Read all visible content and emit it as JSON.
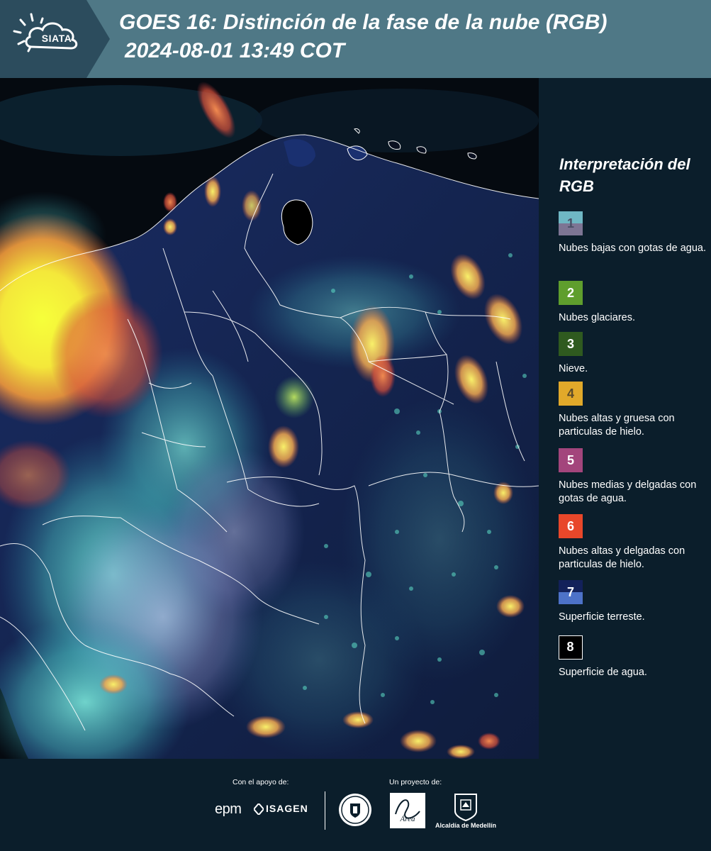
{
  "header": {
    "logo_text": "SIATA",
    "title": "GOES 16: Distinción de la fase de la nube (RGB)",
    "timestamp": "2024-08-01 13:49 COT"
  },
  "legend": {
    "title": "Interpretación del RGB",
    "items": [
      {
        "number": "1",
        "label": "Nubes bajas con gotas de agua.",
        "color_top": "#6fb7c4",
        "color_bottom": "#7d7594",
        "text_color": "#4a4f66"
      },
      {
        "number": "2",
        "label": "Nubes glaciares.",
        "color_top": "#5f9e2d",
        "color_bottom": "#5f9e2d",
        "text_color": "#ffffff"
      },
      {
        "number": "3",
        "label": "Nieve.",
        "color_top": "#2f5a1f",
        "color_bottom": "#2f5a1f",
        "text_color": "#ffffff"
      },
      {
        "number": "4",
        "label": "Nubes altas y gruesa con particulas de hielo.",
        "color_top": "#e1a92a",
        "color_bottom": "#e1a92a",
        "text_color": "#5a4a2a"
      },
      {
        "number": "5",
        "label": "Nubes medias y delgadas con gotas de agua.",
        "color_top": "#a3457c",
        "color_bottom": "#a3457c",
        "text_color": "#ffffff"
      },
      {
        "number": "6",
        "label": "Nubes altas y delgadas con particulas de hielo.",
        "color_top": "#e8472a",
        "color_bottom": "#e8472a",
        "text_color": "#ffffff"
      },
      {
        "number": "7",
        "label": "Superficie terreste.",
        "color_top": "#13215a",
        "color_bottom": "#4d72c8",
        "text_color": "#ffffff"
      },
      {
        "number": "8",
        "label": "Superficie de agua.",
        "color_top": "#000000",
        "color_bottom": "#000000",
        "text_color": "#ffffff"
      }
    ]
  },
  "footer": {
    "support_label": "Con el apoyo de:",
    "project_label": "Un proyecto de:",
    "sponsors": [
      "epm",
      "ISAGEN"
    ],
    "partners": [
      "Área Metropolitana Valle de Aburrá",
      "Alcaldía de Medellín"
    ],
    "medellin_label": "Alcaldía de Medellín"
  },
  "colors": {
    "header_bg": "#4f7886",
    "body_bg": "#0b1e2b",
    "map_land": "#13254f",
    "map_water": "#050a10",
    "border_lines": "#ffffff"
  }
}
